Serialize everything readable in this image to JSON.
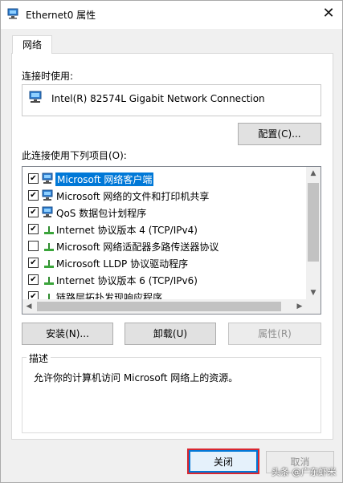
{
  "window": {
    "title": "Ethernet0 属性",
    "close_glyph": "✕"
  },
  "tabs": [
    {
      "label": "网络",
      "active": true
    }
  ],
  "connection": {
    "label": "连接时使用:",
    "adapter_name": "Intel(R) 82574L Gigabit Network Connection",
    "configure_button": "配置(C)..."
  },
  "items": {
    "label": "此连接使用下列项目(O):",
    "list": [
      {
        "text": "Microsoft 网络客户端",
        "checked": true,
        "selected": true,
        "icon": "network-client-icon"
      },
      {
        "text": "Microsoft 网络的文件和打印机共享",
        "checked": true,
        "selected": false,
        "icon": "network-client-icon"
      },
      {
        "text": "QoS 数据包计划程序",
        "checked": true,
        "selected": false,
        "icon": "network-client-icon"
      },
      {
        "text": "Internet 协议版本 4 (TCP/IPv4)",
        "checked": true,
        "selected": false,
        "icon": "protocol-icon"
      },
      {
        "text": "Microsoft 网络适配器多路传送器协议",
        "checked": false,
        "selected": false,
        "icon": "protocol-icon"
      },
      {
        "text": "Microsoft LLDP 协议驱动程序",
        "checked": true,
        "selected": false,
        "icon": "protocol-icon"
      },
      {
        "text": "Internet 协议版本 6 (TCP/IPv6)",
        "checked": true,
        "selected": false,
        "icon": "protocol-icon"
      },
      {
        "text": "链路层拓扑发现响应程序",
        "checked": true,
        "selected": false,
        "icon": "protocol-icon"
      }
    ],
    "check_glyph": "✔"
  },
  "buttons": {
    "install": "安装(N)...",
    "uninstall": "卸载(U)",
    "properties": "属性(R)",
    "ok": "关闭",
    "cancel": "取消"
  },
  "description": {
    "title": "描述",
    "text": "允许你的计算机访问 Microsoft 网络上的资源。"
  },
  "watermark": "头条 @广东虾米",
  "colors": {
    "selection": "#0078d7",
    "highlight_frame": "#d9262f",
    "window_bg": "#f0f0f0"
  }
}
